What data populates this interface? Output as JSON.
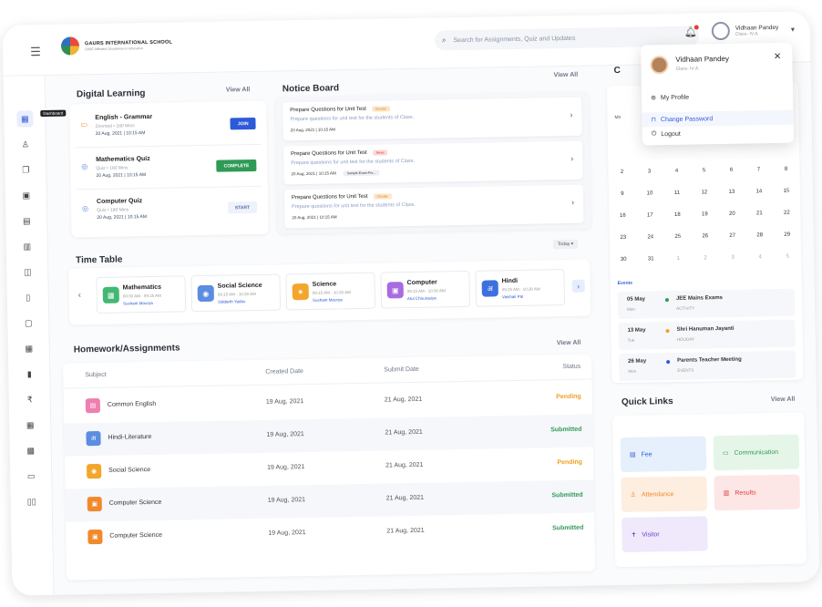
{
  "header": {
    "school_name": "GAURS INTERNATIONAL SCHOOL",
    "school_tagline": "CBSE Affiliated | Excellence in Education",
    "search_placeholder": "Search for Assignments, Quiz and Updates",
    "user_name": "Vidhaan Pandey",
    "user_class": "Class- IV A"
  },
  "sidebar": {
    "tooltip": "Dashboard",
    "icons": [
      "dashboard-icon",
      "user-icon",
      "copy-icon",
      "monitor-icon",
      "doc-icon",
      "board-icon",
      "chart-icon",
      "book-icon",
      "file-icon",
      "calendar-icon",
      "trash-icon",
      "rupee-icon",
      "calendar2-icon",
      "calendar3-icon",
      "chat-icon",
      "library-icon"
    ]
  },
  "digital_learning": {
    "title": "Digital Learning",
    "view_all": "View All",
    "items": [
      {
        "title": "English - Grammar",
        "sub": "Zoomed • 180 Mins",
        "date": "20 Aug, 2021 | 10:15 AM",
        "button": "JOIN"
      },
      {
        "title": "Mathematics Quiz",
        "sub": "Quiz • 180 Mins",
        "date": "20 Aug, 2021 | 10:15 AM",
        "button": "COMPLETE"
      },
      {
        "title": "Computer Quiz",
        "sub": "Quiz • 180 Mins",
        "date": "20 Aug, 2021 | 10:15 AM",
        "button": "START"
      }
    ]
  },
  "notice_board": {
    "title": "Notice Board",
    "view_all": "View All",
    "items": [
      {
        "title": "Prepare Questions for Unit Test",
        "badge": "Circular",
        "desc": "Prepare questions for unit test for the students of Class.",
        "date": "20 Aug, 2021 | 10:15 AM",
        "extra": ""
      },
      {
        "title": "Prepare Questions for Unit Test",
        "badge": "News",
        "desc": "Prepare questions for unit test for the students of Class.",
        "date": "20 Aug, 2021 | 10:15 AM",
        "extra": "Sample-Exam-Pre..."
      },
      {
        "title": "Prepare Questions for Unit Test",
        "badge": "Circular",
        "desc": "Prepare questions for unit test for the students of Class.",
        "date": "20 Aug, 2021 | 10:15 AM",
        "extra": ""
      }
    ]
  },
  "time_table": {
    "title": "Time Table",
    "filter": "Today",
    "items": [
      {
        "subject": "Mathematics",
        "time": "08:30 AM - 09:15 AM",
        "teacher": "Sushant Mourya",
        "color": "#43b874"
      },
      {
        "subject": "Social Science",
        "time": "09:15 AM - 10:30 AM",
        "teacher": "Siddarth Yadav",
        "color": "#5b8de0"
      },
      {
        "subject": "Science",
        "time": "09:15 AM - 10:30 AM",
        "teacher": "Sushant Mourya",
        "color": "#f4a52c"
      },
      {
        "subject": "Computer",
        "time": "09:15 AM - 10:30 AM",
        "teacher": "Atul Chourasiya",
        "color": "#a86be0"
      },
      {
        "subject": "Hindi",
        "time": "09:15 AM - 10:30 AM",
        "teacher": "Vaishali Pal",
        "color": "#3d6fe0"
      }
    ]
  },
  "homework": {
    "title": "Homework/Assignments",
    "view_all": "View All",
    "columns": [
      "Subject",
      "Created Date",
      "Submit Date",
      "Status"
    ],
    "rows": [
      {
        "subject": "Common English",
        "created": "19 Aug, 2021",
        "submit": "21 Aug, 2021",
        "status": "Pending",
        "color": "#ef7fb0"
      },
      {
        "subject": "Hindi-Literature",
        "created": "19 Aug, 2021",
        "submit": "21 Aug, 2021",
        "status": "Submitted",
        "color": "#5b8de0"
      },
      {
        "subject": "Social Science",
        "created": "19 Aug, 2021",
        "submit": "21 Aug, 2021",
        "status": "Pending",
        "color": "#f4a52c"
      },
      {
        "subject": "Computer Science",
        "created": "19 Aug, 2021",
        "submit": "21 Aug, 2021",
        "status": "Submitted",
        "color": "#f08a2c"
      },
      {
        "subject": "Computer Science",
        "created": "19 Aug, 2021",
        "submit": "21 Aug, 2021",
        "status": "Submitted",
        "color": "#f08a2c"
      }
    ],
    "pending_color": "#f0a020",
    "submitted_color": "#2f9a55"
  },
  "calendar": {
    "title_letter": "C",
    "weekday_label": "Mo",
    "rows": [
      [
        "2",
        "3",
        "4",
        "5",
        "6",
        "7",
        "8"
      ],
      [
        "9",
        "10",
        "11",
        "12",
        "13",
        "14",
        "15"
      ],
      [
        "16",
        "17",
        "18",
        "19",
        "20",
        "21",
        "22"
      ],
      [
        "23",
        "24",
        "25",
        "26",
        "27",
        "28",
        "29"
      ],
      [
        "30",
        "31",
        "1",
        "2",
        "3",
        "4",
        "5"
      ]
    ],
    "events_label": "Events",
    "events": [
      {
        "date": "05 May",
        "day": "Mon",
        "title": "JEE Mains Exams",
        "cat": "ACTIVITY",
        "color": "#2f9a55"
      },
      {
        "date": "13 May",
        "day": "Tue",
        "title": "Shri Hanuman Jayanti",
        "cat": "HOLIDAY",
        "color": "#f0a020"
      },
      {
        "date": "26 May",
        "day": "Mon",
        "title": "Parents Teacher Meeting",
        "cat": "EVENTS",
        "color": "#2d5bd8"
      }
    ]
  },
  "quick_links": {
    "title": "Quick Links",
    "view_all": "View All",
    "items": [
      {
        "label": "Fee",
        "bg": "#e6f0fc",
        "fg": "#2d5bd8",
        "icon": "receipt-icon",
        "glyph": "▤"
      },
      {
        "label": "Communication",
        "bg": "#e5f6e9",
        "fg": "#2f9a55",
        "icon": "message-icon",
        "glyph": "▭"
      },
      {
        "label": "Attendance",
        "bg": "#fdeee0",
        "fg": "#f08a2c",
        "icon": "users-icon",
        "glyph": "♙"
      },
      {
        "label": "Results",
        "bg": "#fde6e6",
        "fg": "#e23b3b",
        "icon": "results-icon",
        "glyph": "▥"
      },
      {
        "label": "Visitor",
        "bg": "#efe9fb",
        "fg": "#6a3fc8",
        "icon": "walk-icon",
        "glyph": "✝"
      }
    ]
  },
  "profile_menu": {
    "name": "Vidhaan Pandey",
    "class": "Class- IV A",
    "items": [
      "My Profile",
      "Change Password",
      "Logout"
    ]
  }
}
